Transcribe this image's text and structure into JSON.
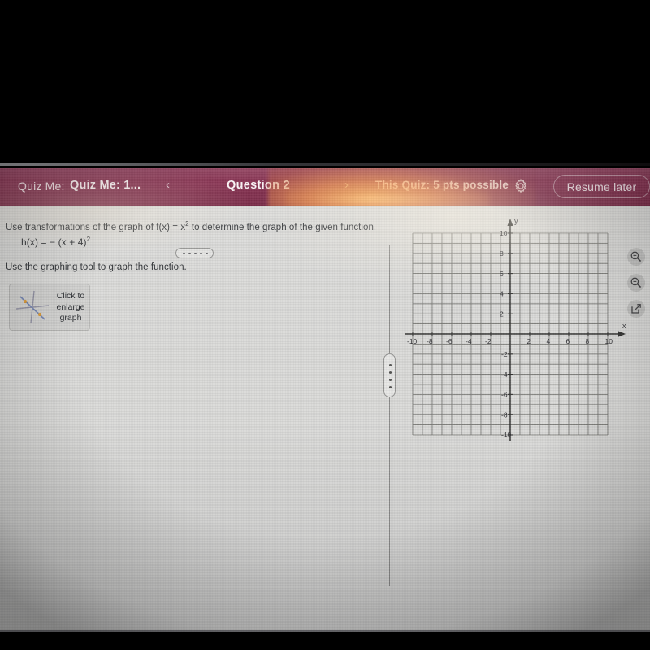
{
  "topbar": {
    "quiz_label": "Quiz Me:",
    "quiz_name": "Quiz Me: 1...",
    "prev_icon": "chevron-left-icon",
    "prev_glyph": "‹",
    "question_number": "Question 2",
    "next_icon": "chevron-right-icon",
    "next_glyph": "›",
    "points": "This Quiz: 5 pts possible",
    "settings_icon": "gear-icon",
    "resume_later": "Resume later",
    "bar_color": "#78163a",
    "text_color": "#f0dde4"
  },
  "question": {
    "prompt": "Use transformations of the graph of f(x) = x",
    "prompt_exp": "2",
    "prompt_tail": " to determine the graph of the given function.",
    "equation_lhs": "h(x) = − (x + 4)",
    "equation_exp": "2",
    "instruction": "Use the graphing tool to graph the function.",
    "enlarge_label": "Click to enlarge graph",
    "enlarge_icon": "graph-thumbnail-icon"
  },
  "splitters": {
    "vertical_handle": "vertical-splitter-handle",
    "horizontal_handle": "horizontal-splitter-handle",
    "dot_count": 4,
    "hdot_count": 5
  },
  "graph_tools": [
    {
      "name": "zoom-in-icon",
      "label": "Zoom in"
    },
    {
      "name": "zoom-out-icon",
      "label": "Zoom out"
    },
    {
      "name": "open-external-icon",
      "label": "Open graph in new window"
    }
  ],
  "chart_data": {
    "type": "scatter",
    "title": "",
    "xlabel": "x",
    "ylabel": "y",
    "xlim": [
      -10,
      10
    ],
    "ylim": [
      -10,
      10
    ],
    "xticks": [
      -10,
      -8,
      -6,
      -4,
      -2,
      2,
      4,
      6,
      8,
      10
    ],
    "yticks": [
      10,
      8,
      6,
      4,
      2,
      -2,
      -4,
      -6,
      -8,
      -10
    ],
    "xtick_labels": [
      "-10",
      "-8",
      "-6",
      "-4",
      "-2",
      "2",
      "4",
      "6",
      "8",
      "10"
    ],
    "ytick_labels": [
      "10",
      "8",
      "6",
      "4",
      "2",
      "-2",
      "-4",
      "-6",
      "-8",
      "-10"
    ],
    "grid": true,
    "grid_step": 1,
    "tick_step": 2,
    "axis_arrows": true,
    "series": [],
    "values": [],
    "legend": "none",
    "note": "Empty graphing-tool coordinate plane; no curve has been plotted yet."
  },
  "colors": {
    "brand": "#78163a",
    "screen_bg": "#d9d9d7",
    "grid_line": "#6e6e6c",
    "axis_line": "#2e2e2c",
    "glare": "#f08c36"
  }
}
